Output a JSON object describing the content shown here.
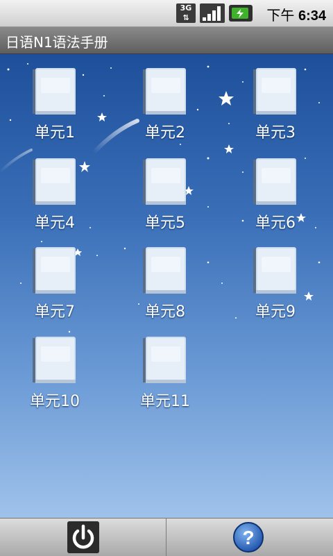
{
  "status_bar": {
    "network": "3G",
    "time_prefix": "下午",
    "time": "6:34"
  },
  "app": {
    "title": "日语N1语法手册"
  },
  "units": [
    {
      "label": "单元1"
    },
    {
      "label": "单元2"
    },
    {
      "label": "单元3"
    },
    {
      "label": "单元4"
    },
    {
      "label": "单元5"
    },
    {
      "label": "单元6"
    },
    {
      "label": "单元7"
    },
    {
      "label": "单元8"
    },
    {
      "label": "单元9"
    },
    {
      "label": "单元10"
    },
    {
      "label": "单元11"
    }
  ],
  "bottom_bar": {
    "left_icon": "power-icon",
    "right_icon": "help-icon"
  }
}
